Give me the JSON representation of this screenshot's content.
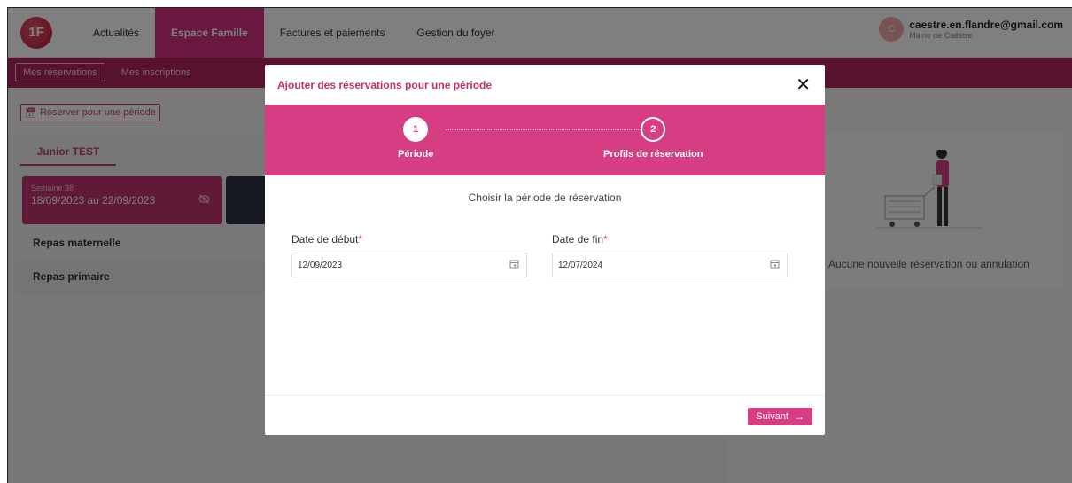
{
  "topbar": {
    "logo_text": "1F",
    "nav": [
      "Actualités",
      "Espace Famille",
      "Factures et paiements",
      "Gestion du foyer"
    ],
    "active_nav": "Espace Famille",
    "user": {
      "avatar_initial": "C",
      "email": "caestre.en.flandre@gmail.com",
      "org": "Mairie de Caëstre"
    }
  },
  "subnav": {
    "items": [
      "Mes réservations",
      "Mes inscriptions"
    ]
  },
  "page": {
    "reserve_button": "Réserver pour une période",
    "child_tab": "Junior TEST",
    "week": {
      "label": "Semaine 38",
      "dates": "18/09/2023 au 22/09/2023"
    },
    "rows": [
      "Repas maternelle",
      "Repas primaire"
    ],
    "empty_message": "Aucune nouvelle réservation ou annulation"
  },
  "modal": {
    "title": "Ajouter des réservations pour une période",
    "close_glyph": "✕",
    "steps": [
      {
        "number": "1",
        "label": "Période"
      },
      {
        "number": "2",
        "label": "Profils de réservation"
      }
    ],
    "subtitle": "Choisir la période de réservation",
    "start": {
      "label": "Date de début",
      "required": "*",
      "value": "12/09/2023"
    },
    "end": {
      "label": "Date de fin",
      "required": "*",
      "value": "12/07/2024"
    },
    "next_button": "Suivant",
    "next_arrow": "→"
  },
  "colors": {
    "accent": "#d63d83",
    "subnav": "#b1255f",
    "overlay": "rgba(0,0,0,0.5)"
  },
  "icons": [
    "logo",
    "calendar-icon",
    "eye-slash-icon",
    "close-icon",
    "arrow-right-icon",
    "cart-illustration"
  ]
}
